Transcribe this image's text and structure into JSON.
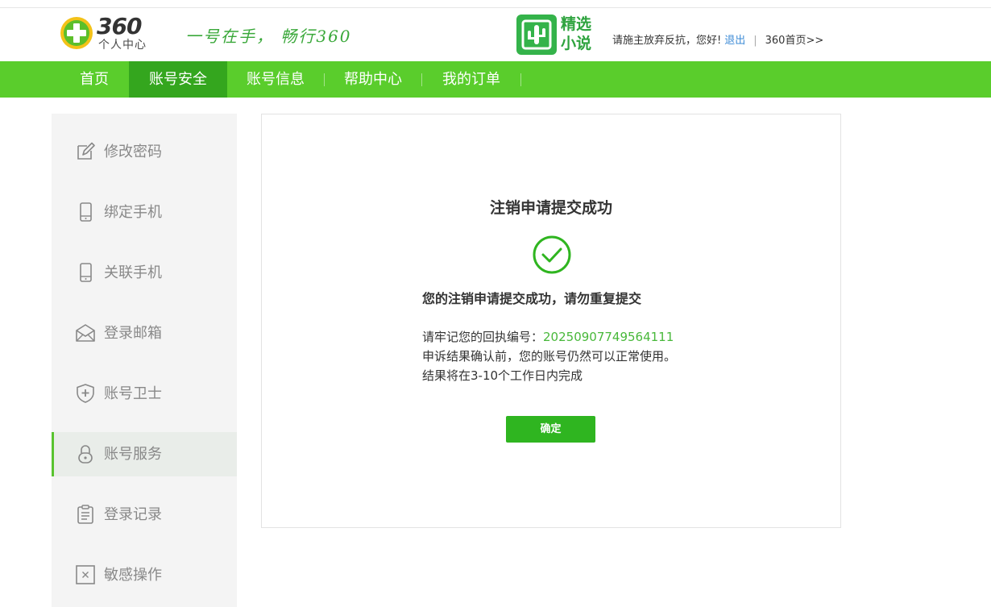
{
  "header": {
    "logo_number": "360",
    "logo_subtitle": "个人中心",
    "slogan": "一号在手， 畅行360",
    "novel_line1": "精选",
    "novel_line2": "小说",
    "greeting": "请施主放弃反抗，您好!",
    "logout_label": "退出",
    "separator": "|",
    "home_link_label": "360首页>>"
  },
  "nav": {
    "items": [
      {
        "label": "首页"
      },
      {
        "label": "账号安全"
      },
      {
        "label": "账号信息"
      },
      {
        "label": "帮助中心"
      },
      {
        "label": "我的订单"
      }
    ],
    "active_index": 1
  },
  "sidebar": {
    "items": [
      {
        "label": "修改密码",
        "icon": "edit-icon"
      },
      {
        "label": "绑定手机",
        "icon": "phone-icon"
      },
      {
        "label": "关联手机",
        "icon": "phone-icon"
      },
      {
        "label": "登录邮箱",
        "icon": "mail-icon"
      },
      {
        "label": "账号卫士",
        "icon": "shield-icon"
      },
      {
        "label": "账号服务",
        "icon": "lock-icon"
      },
      {
        "label": "登录记录",
        "icon": "clipboard-icon"
      },
      {
        "label": "敏感操作",
        "icon": "close-box-icon"
      }
    ],
    "active_index": 5
  },
  "main": {
    "title": "注销申请提交成功",
    "status_icon": "check-circle-icon",
    "message": "您的注销申请提交成功，请勿重复提交",
    "receipt_label": "请牢记您的回执编号：",
    "receipt_number": "20250907749564111",
    "note_line1": "申诉结果确认前，您的账号仍然可以正常使用。",
    "note_line2": "结果将在3-10个工作日内完成",
    "confirm_label": "确定"
  },
  "colors": {
    "nav_bg": "#5acd2c",
    "nav_active": "#34a61e",
    "success_green": "#2fb520",
    "link_blue": "#3d8bd6"
  }
}
